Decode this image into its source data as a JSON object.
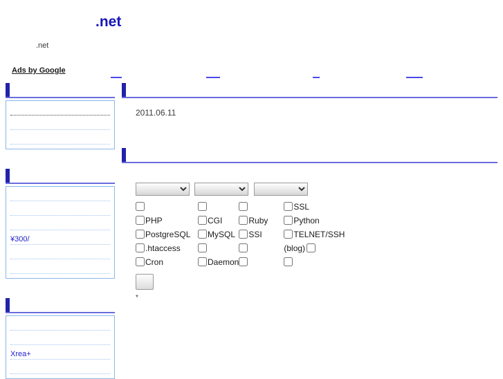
{
  "header": {
    "title": ".net",
    "subtitle": ".net"
  },
  "ads": {
    "label": "Ads by Google",
    "links": [
      "",
      "",
      "",
      ""
    ]
  },
  "sidebar": {
    "sections": [
      {
        "heading": "",
        "items": [
          {
            "text": "",
            "style": "dark"
          },
          {
            "text": "",
            "style": "light"
          },
          {
            "text": "",
            "style": "light"
          }
        ]
      },
      {
        "heading": "",
        "items": [
          {
            "text": "",
            "style": "light"
          },
          {
            "text": "",
            "style": "light"
          },
          {
            "text": "",
            "style": "light"
          },
          {
            "text": "¥300/",
            "style": "light"
          },
          {
            "text": "",
            "style": "light"
          },
          {
            "text": "",
            "style": "light"
          }
        ]
      },
      {
        "heading": "",
        "items": [
          {
            "text": "",
            "style": "light"
          },
          {
            "text": "",
            "style": "light"
          },
          {
            "text": "Xrea+",
            "style": "light"
          },
          {
            "text": "",
            "style": "light"
          }
        ]
      }
    ]
  },
  "content": {
    "sections": [
      {
        "heading": "",
        "date": "2011.06.11"
      },
      {
        "heading": ""
      }
    ],
    "form": {
      "selects": [
        {
          "name": "select-1",
          "value": "",
          "options": [
            ""
          ]
        },
        {
          "name": "select-2",
          "value": "",
          "options": [
            ""
          ]
        },
        {
          "name": "select-3",
          "value": "",
          "options": [
            ""
          ]
        }
      ],
      "checkbox_rows": [
        [
          {
            "label": "",
            "pre_label": "",
            "checked": false
          },
          {
            "label": "",
            "pre_label": "",
            "checked": false
          },
          {
            "label": "",
            "pre_label": "",
            "checked": false
          },
          {
            "label": "SSL",
            "pre_label": "",
            "checked": false
          }
        ],
        [
          {
            "label": "PHP",
            "pre_label": "",
            "checked": false
          },
          {
            "label": "CGI",
            "pre_label": "",
            "checked": false
          },
          {
            "label": "Ruby",
            "pre_label": "",
            "checked": false
          },
          {
            "label": "Python",
            "pre_label": "",
            "checked": false
          }
        ],
        [
          {
            "label": "PostgreSQL",
            "pre_label": "",
            "checked": false
          },
          {
            "label": "MySQL",
            "pre_label": "",
            "checked": false
          },
          {
            "label": "SSI",
            "pre_label": "",
            "checked": false
          },
          {
            "label": "TELNET/SSH",
            "pre_label": "",
            "checked": false
          }
        ],
        [
          {
            "label": ".htaccess",
            "pre_label": "",
            "checked": false
          },
          {
            "label": "",
            "pre_label": "",
            "checked": false
          },
          {
            "label": "",
            "pre_label": "",
            "checked": false
          },
          {
            "label": "",
            "pre_label": "(blog)",
            "checked": false
          }
        ],
        [
          {
            "label": "Cron",
            "pre_label": "",
            "checked": false
          },
          {
            "label": "Daemon",
            "pre_label": "",
            "checked": false
          },
          {
            "label": "",
            "pre_label": "",
            "checked": false
          },
          {
            "label": "",
            "pre_label": "",
            "checked": false
          }
        ]
      ],
      "submit_label": "",
      "note": "*"
    }
  },
  "colors": {
    "title_blue": "#1717b8",
    "heading_bar": "#2222aa",
    "heading_rule": "#6b6bdd",
    "box_border": "#8ab6e8",
    "link_blue": "#2222cc",
    "ad_underline": "#4a4ae8"
  }
}
